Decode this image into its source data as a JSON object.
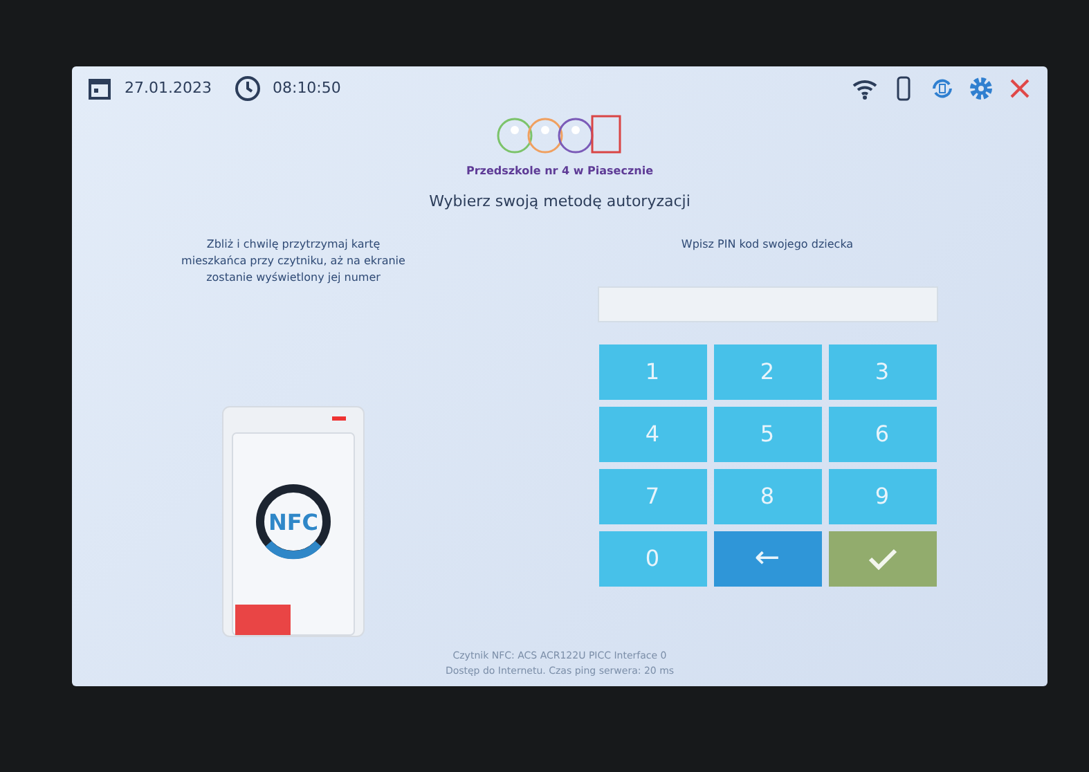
{
  "top_bar": {
    "date": "27.01.2023",
    "time": "08:10:50"
  },
  "logo": {
    "caption": "Przedszkole nr 4 w Piasecznie"
  },
  "heading": "Wybierz swoją metodę autoryzacji",
  "card_panel": {
    "instruction": "Zbliż i chwilę przytrzymaj kartę mieszkańca przy czytniku, aż na ekranie zostanie wyświetlony jej numer",
    "reader_label": "NFC"
  },
  "pin_panel": {
    "instruction": "Wpisz PIN kod swojego dziecka",
    "keys": [
      {
        "kind": "digit",
        "label": "1"
      },
      {
        "kind": "digit",
        "label": "2"
      },
      {
        "kind": "digit",
        "label": "3"
      },
      {
        "kind": "digit",
        "label": "4"
      },
      {
        "kind": "digit",
        "label": "5"
      },
      {
        "kind": "digit",
        "label": "6"
      },
      {
        "kind": "digit",
        "label": "7"
      },
      {
        "kind": "digit",
        "label": "8"
      },
      {
        "kind": "digit",
        "label": "9"
      },
      {
        "kind": "digit",
        "label": "0"
      },
      {
        "kind": "back",
        "label": "←"
      },
      {
        "kind": "ok"
      }
    ]
  },
  "status_lines": [
    "Czytnik NFC: ACS ACR122U PICC Interface 0",
    "Dostęp do Internetu. Czas ping serwera: 20 ms"
  ]
}
